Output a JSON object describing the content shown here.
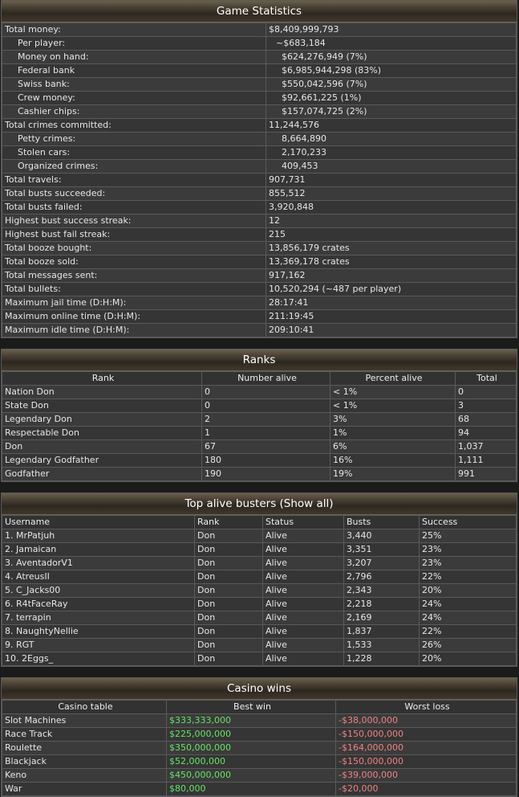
{
  "stats": {
    "title": "Game Statistics",
    "rows": [
      {
        "label": "Total money:",
        "value": "$8,409,999,793",
        "indent": 0
      },
      {
        "label": "Per player:",
        "value": "~$683,184",
        "indent": 1
      },
      {
        "label": "Money on hand:",
        "value": "$624,276,949 (7%)",
        "indent": 2
      },
      {
        "label": "Federal bank",
        "value": "$6,985,944,298 (83%)",
        "indent": 2
      },
      {
        "label": "Swiss bank:",
        "value": "$550,042,596 (7%)",
        "indent": 2
      },
      {
        "label": "Crew money:",
        "value": "$92,661,225 (1%)",
        "indent": 2
      },
      {
        "label": "Cashier chips:",
        "value": "$157,074,725 (2%)",
        "indent": 2
      },
      {
        "label": "Total crimes committed:",
        "value": "11,244,576",
        "indent": 0
      },
      {
        "label": "Petty crimes:",
        "value": "8,664,890",
        "indent": 3
      },
      {
        "label": "Stolen cars:",
        "value": "2,170,233",
        "indent": 3
      },
      {
        "label": "Organized crimes:",
        "value": "409,453",
        "indent": 3
      },
      {
        "label": "Total travels:",
        "value": "907,731",
        "indent": 0
      },
      {
        "label": "Total busts succeeded:",
        "value": "855,512",
        "indent": 0
      },
      {
        "label": "Total busts failed:",
        "value": "3,920,848",
        "indent": 0
      },
      {
        "label": "Highest bust success streak:",
        "value": "12",
        "indent": 0
      },
      {
        "label": "Highest bust fail streak:",
        "value": "215",
        "indent": 0
      },
      {
        "label": "Total booze bought:",
        "value": "13,856,179 crates",
        "indent": 0
      },
      {
        "label": "Total booze sold:",
        "value": "13,369,178 crates",
        "indent": 0
      },
      {
        "label": "Total messages sent:",
        "value": "917,162",
        "indent": 0
      },
      {
        "label": "Total bullets:",
        "value": "10,520,294 (~487 per player)",
        "indent": 0
      },
      {
        "label": "Maximum jail time (D:H:M):",
        "value": "28:17:41",
        "indent": 0
      },
      {
        "label": "Maximum online time (D:H:M):",
        "value": "211:19:45",
        "indent": 0
      },
      {
        "label": "Maximum idle time (D:H:M):",
        "value": "209:10:41",
        "indent": 0
      }
    ]
  },
  "ranks": {
    "title": "Ranks",
    "headers": [
      "Rank",
      "Number alive",
      "Percent alive",
      "Total"
    ],
    "rows": [
      [
        "Nation Don",
        "0",
        "< 1%",
        "0"
      ],
      [
        "State Don",
        "0",
        "< 1%",
        "3"
      ],
      [
        "Legendary Don",
        "2",
        "3%",
        "68"
      ],
      [
        "Respectable Don",
        "1",
        "1%",
        "94"
      ],
      [
        "Don",
        "67",
        "6%",
        "1,037"
      ],
      [
        "Legendary Godfather",
        "180",
        "16%",
        "1,111"
      ],
      [
        "Godfather",
        "190",
        "19%",
        "991"
      ]
    ]
  },
  "busters": {
    "title": "Top alive busters (Show all)",
    "headers": [
      "Username",
      "Rank",
      "Status",
      "Busts",
      "Success"
    ],
    "rows": [
      [
        "1. MrPatjuh",
        "Don",
        "Alive",
        "3,440",
        "25%"
      ],
      [
        "2. Jamaican",
        "Don",
        "Alive",
        "3,351",
        "23%"
      ],
      [
        "3. AventadorV1",
        "Don",
        "Alive",
        "3,207",
        "23%"
      ],
      [
        "4. AtreusII",
        "Don",
        "Alive",
        "2,796",
        "22%"
      ],
      [
        "5. C_Jacks00",
        "Don",
        "Alive",
        "2,343",
        "20%"
      ],
      [
        "6. R4tFaceRay",
        "Don",
        "Alive",
        "2,218",
        "24%"
      ],
      [
        "7. terrapin",
        "Don",
        "Alive",
        "2,169",
        "24%"
      ],
      [
        "8. NaughtyNellie",
        "Don",
        "Alive",
        "1,837",
        "22%"
      ],
      [
        "9. RGT",
        "Don",
        "Alive",
        "1,533",
        "26%"
      ],
      [
        "10. 2Eggs_",
        "Don",
        "Alive",
        "1,228",
        "20%"
      ]
    ]
  },
  "casino": {
    "title": "Casino wins",
    "headers": [
      "Casino table",
      "Best win",
      "Worst loss"
    ],
    "rows": [
      [
        "Slot Machines",
        "$333,333,000",
        "-$38,000,000"
      ],
      [
        "Race Track",
        "$225,000,000",
        "-$150,000,000"
      ],
      [
        "Roulette",
        "$350,000,000",
        "-$164,000,000"
      ],
      [
        "Blackjack",
        "$52,000,000",
        "-$150,000,000"
      ],
      [
        "Keno",
        "$450,000,000",
        "-$39,000,000"
      ],
      [
        "War",
        "$80,000",
        "-$20,000"
      ]
    ]
  },
  "colors": {
    "win": "#66e466",
    "loss": "#f08282"
  }
}
